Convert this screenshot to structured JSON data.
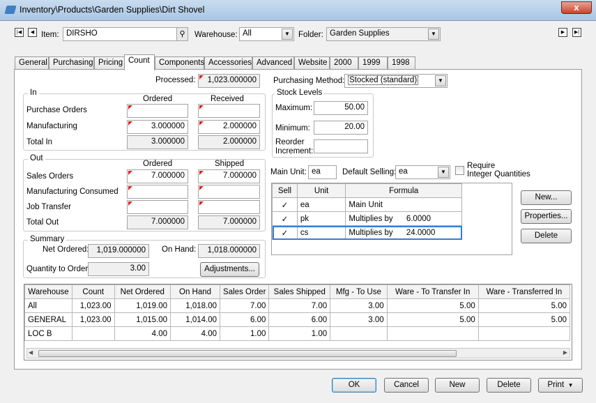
{
  "window": {
    "title": "Inventory\\Products\\Garden Supplies\\Dirt Shovel",
    "close": "x"
  },
  "header": {
    "item_label": "Item:",
    "item_value": "DIRSHO",
    "warehouse_label": "Warehouse:",
    "warehouse_value": "All",
    "folder_label": "Folder:",
    "folder_value": "Garden Supplies"
  },
  "tabs": [
    "General",
    "Purchasing",
    "Pricing",
    "Count",
    "Components",
    "Accessories",
    "Advanced",
    "Website",
    "2000",
    "1999",
    "1998"
  ],
  "processed": {
    "label": "Processed:",
    "value": "1,023.000000"
  },
  "purchasing_method": {
    "label": "Purchasing Method:",
    "value": "Stocked (standard)"
  },
  "in_group": {
    "title": "In",
    "col_ordered": "Ordered",
    "col_received": "Received",
    "rows": [
      {
        "label": "Purchase Orders",
        "ordered": "",
        "received": ""
      },
      {
        "label": "Manufacturing",
        "ordered": "3.000000",
        "received": "2.000000"
      },
      {
        "label": "Total In",
        "ordered": "3.000000",
        "received": "2.000000"
      }
    ]
  },
  "out_group": {
    "title": "Out",
    "col_ordered": "Ordered",
    "col_shipped": "Shipped",
    "rows": [
      {
        "label": "Sales Orders",
        "ordered": "7.000000",
        "shipped": "7.000000"
      },
      {
        "label": "Manufacturing Consumed",
        "ordered": "",
        "shipped": ""
      },
      {
        "label": "Job Transfer",
        "ordered": "",
        "shipped": ""
      },
      {
        "label": "Total Out",
        "ordered": "7.000000",
        "shipped": "7.000000"
      }
    ]
  },
  "summary": {
    "title": "Summary",
    "net_ordered_label": "Net Ordered:",
    "net_ordered": "1,019.000000",
    "on_hand_label": "On Hand:",
    "on_hand": "1,018.000000",
    "qty_label": "Quantity to Order:",
    "qty": "3.00",
    "adjustments": "Adjustments..."
  },
  "stock_levels": {
    "title": "Stock Levels",
    "maximum_label": "Maximum:",
    "maximum": "50.00",
    "minimum_label": "Minimum:",
    "minimum": "20.00",
    "reorder_label1": "Reorder",
    "reorder_label2": "Increment:",
    "reorder": ""
  },
  "units": {
    "main_unit_label": "Main Unit:",
    "main_unit": "ea",
    "default_selling_label": "Default Selling:",
    "default_selling": "ea",
    "require_label1": "Require",
    "require_label2": "Integer Quantities",
    "columns": [
      "Sell",
      "Unit",
      "Formula"
    ],
    "rows": [
      {
        "sell": "✓",
        "unit": "ea",
        "formula": "Main Unit"
      },
      {
        "sell": "✓",
        "unit": "pk",
        "formula": "Multiplies by      6.0000"
      },
      {
        "sell": "✓",
        "unit": "cs",
        "formula": "Multiplies by      24.0000"
      }
    ],
    "new": "New...",
    "properties": "Properties...",
    "delete": "Delete"
  },
  "warehouse_grid": {
    "columns": [
      "Warehouse",
      "Count",
      "Net Ordered",
      "On Hand",
      "Sales Order",
      "Sales Shipped",
      "Mfg - To Use",
      "Ware - To Transfer In",
      "Ware - Transferred In"
    ],
    "rows": [
      [
        "All",
        "1,023.00",
        "1,019.00",
        "1,018.00",
        "7.00",
        "7.00",
        "3.00",
        "5.00",
        "5.00"
      ],
      [
        "GENERAL",
        "1,023.00",
        "1,015.00",
        "1,014.00",
        "6.00",
        "6.00",
        "3.00",
        "5.00",
        "5.00"
      ],
      [
        "LOC B",
        "",
        "4.00",
        "4.00",
        "1.00",
        "1.00",
        "",
        "",
        ""
      ]
    ]
  },
  "footer": {
    "ok": "OK",
    "cancel": "Cancel",
    "new": "New",
    "delete": "Delete",
    "print": "Print"
  }
}
